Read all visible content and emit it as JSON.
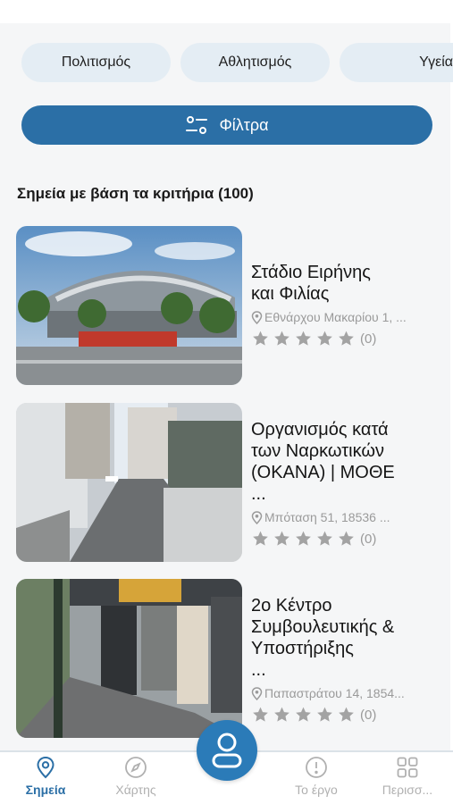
{
  "filters": {
    "chips": [
      "Πολιτισμός",
      "Αθλητισμός",
      "Υγεία"
    ],
    "button_label": "Φίλτρα"
  },
  "results": {
    "title": "Σημεία με βάση τα κριτήρια (100)",
    "items": [
      {
        "title_lines": [
          "Στάδιο Ειρήνης",
          "και Φιλίας"
        ],
        "address": "Εθνάρχου Μακαρίου 1, ...",
        "rating_count": "(0)",
        "image": "stadium-photo"
      },
      {
        "title_lines": [
          "Οργανισμός κατά",
          "των Ναρκωτικών",
          "(ΟΚΑΝΑ) | ΜΟΘΕ",
          "..."
        ],
        "address": "Μπόταση 51, 18536 ...",
        "rating_count": "(0)",
        "image": "street-ramp-photo"
      },
      {
        "title_lines": [
          "2ο Κέντρο",
          "Συμβουλευτικής &",
          "Υποστήριξης",
          "..."
        ],
        "address": "Παπαστράτου 14, 1854...",
        "rating_count": "(0)",
        "image": "storefront-photo"
      }
    ]
  },
  "bottom_nav": {
    "items": [
      {
        "label": "Σημεία",
        "icon": "map-pin-icon",
        "active": true
      },
      {
        "label": "Χάρτης",
        "icon": "compass-icon",
        "active": false
      },
      {
        "label": "Το έργο",
        "icon": "info-icon",
        "active": false
      },
      {
        "label": "Περισσ...",
        "icon": "grid-icon",
        "active": false
      }
    ],
    "fab_icon": "user-icon"
  },
  "colors": {
    "accent": "#2b6fa6",
    "chip_bg": "#e4edf4",
    "muted": "#9a9a9a"
  }
}
